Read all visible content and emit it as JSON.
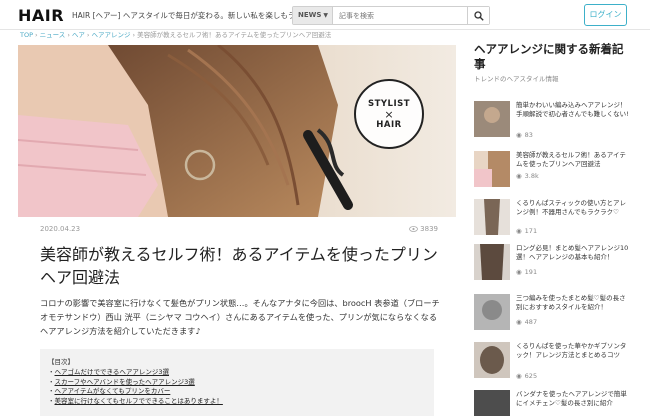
{
  "header": {
    "logo": "HAIR",
    "tagline": "HAIR [ヘアー] ヘアスタイルで毎日が変わる。新しい私を楽しもう。",
    "search_select": "NEWS",
    "search_placeholder": "記事を検索",
    "login": "ログイン"
  },
  "breadcrumb": {
    "items": [
      "TOP",
      "ニュース",
      "ヘア",
      "ヘアアレンジ"
    ],
    "current": "美容師が教えるセルフ術！あるアイテムを使ったプリンヘア回避法"
  },
  "hero": {
    "badge_top": "STYLIST",
    "badge_x": "×",
    "badge_bottom": "HAIR"
  },
  "article": {
    "date": "2020.04.23",
    "views": "3839",
    "title": "美容師が教えるセルフ術！あるアイテムを使ったプリンヘア回避法",
    "lead": "コロナの影響で美容室に行けなくて髪色がプリン状態…。そんなアナタに今回は、broocH 表参道（ブローチ オモテサンドウ）西山 洸平（ニシヤマ コウヘイ）さんにあるアイテムを使った、プリンが気にならなくなるヘアアレンジ方法を紹介していただきます♪",
    "toc_title": "【目次】",
    "toc": [
      "ヘアゴムだけでできるヘアアレンジ3選",
      "スカーフやヘアバンドを使ったヘアアレンジ3選",
      "ヘアアイテムがなくてもプリンをカバー",
      "美容室に行けなくてもセルフでできることはありますよ！"
    ]
  },
  "sidebar": {
    "title": "ヘアアレンジに関する新着記事",
    "subtitle": "トレンドのヘアスタイル情報",
    "items": [
      {
        "text": "簡単かわいい編み込みヘアアレンジ！手順解説で初心者さんでも難しくない!",
        "views": "83",
        "thumb_color": "#9b8a7a"
      },
      {
        "text": "美容師が教えるセルフ術！あるアイテムを使ったプリンヘア回避法",
        "views": "3.8k",
        "thumb_color": "#c9a98c"
      },
      {
        "text": "くるりんぱスティックの使い方とアレンジ例！不器用さんでもラクラク♡",
        "views": "171",
        "thumb_color": "#7a6656"
      },
      {
        "text": "ロング必見！まとめ髪ヘアアレンジ10選！ヘアアレンジの基本も紹介！",
        "views": "191",
        "thumb_color": "#5c4a3e"
      },
      {
        "text": "三つ編みを使ったまとめ髪♡髪の長さ別におすすめスタイルを紹介！",
        "views": "487",
        "thumb_color": "#8a8a8a"
      },
      {
        "text": "くるりんぱを使った華やかギブソンタック！アレンジ方法とまとめるコツ",
        "views": "625",
        "thumb_color": "#6b5a4c"
      },
      {
        "text": "バンダナを使ったヘアアレンジで簡単にイメチェン♡髪の長さ別に紹介",
        "views": "",
        "thumb_color": "#4d4d4d"
      }
    ]
  }
}
